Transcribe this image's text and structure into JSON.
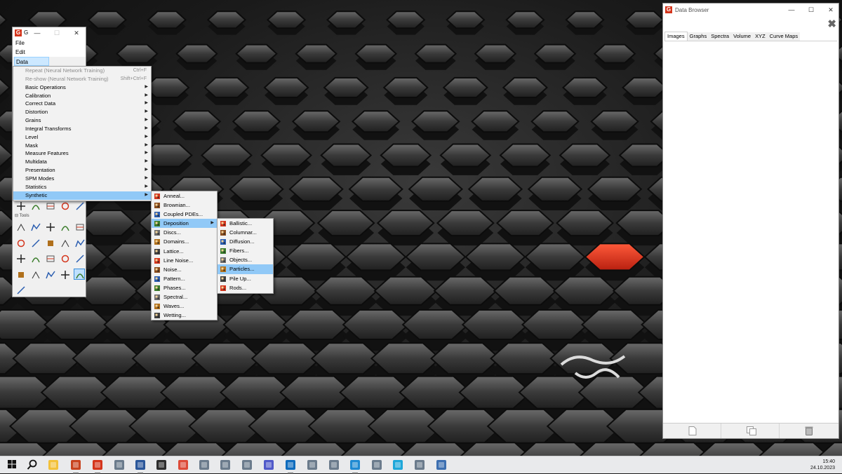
{
  "main_window": {
    "title": "G",
    "menus": [
      "File",
      "Edit",
      "Data Process"
    ],
    "tools_label": "Tools"
  },
  "data_process_menu": [
    {
      "label": "Repeat (Neural Network Training)",
      "shortcut": "Ctrl+F",
      "disabled": true
    },
    {
      "label": "Re-show (Neural Network Training)",
      "shortcut": "Shift+Ctrl+F",
      "disabled": true
    },
    {
      "label": "Basic Operations",
      "submenu": true
    },
    {
      "label": "Calibration",
      "submenu": true
    },
    {
      "label": "Correct Data",
      "submenu": true
    },
    {
      "label": "Distortion",
      "submenu": true
    },
    {
      "label": "Grains",
      "submenu": true
    },
    {
      "label": "Integral Transforms",
      "submenu": true
    },
    {
      "label": "Level",
      "submenu": true
    },
    {
      "label": "Mask",
      "submenu": true
    },
    {
      "label": "Measure Features",
      "submenu": true
    },
    {
      "label": "Multidata",
      "submenu": true
    },
    {
      "label": "Presentation",
      "submenu": true
    },
    {
      "label": "SPM Modes",
      "submenu": true
    },
    {
      "label": "Statistics",
      "submenu": true
    },
    {
      "label": "Synthetic",
      "submenu": true,
      "highlighted": true
    }
  ],
  "synthetic_menu": [
    {
      "label": "Anneal...",
      "icon": "anneal-icon"
    },
    {
      "label": "Brownian...",
      "icon": "brownian-icon"
    },
    {
      "label": "Coupled PDEs...",
      "icon": "coupled-pdes-icon"
    },
    {
      "label": "Deposition",
      "icon": "deposition-icon",
      "submenu": true,
      "highlighted": true
    },
    {
      "label": "Discs...",
      "icon": "discs-icon"
    },
    {
      "label": "Domains...",
      "icon": "domains-icon"
    },
    {
      "label": "Lattice...",
      "icon": "lattice-icon"
    },
    {
      "label": "Line Noise...",
      "icon": "line-noise-icon"
    },
    {
      "label": "Noise...",
      "icon": "noise-icon"
    },
    {
      "label": "Pattern...",
      "icon": "pattern-icon"
    },
    {
      "label": "Phases...",
      "icon": "phases-icon"
    },
    {
      "label": "Spectral...",
      "icon": "spectral-icon"
    },
    {
      "label": "Waves...",
      "icon": "waves-icon"
    },
    {
      "label": "Wetting...",
      "icon": "wetting-icon"
    }
  ],
  "deposition_menu": [
    {
      "label": "Ballistic...",
      "icon": "ballistic-icon"
    },
    {
      "label": "Columnar...",
      "icon": "columnar-icon"
    },
    {
      "label": "Diffusion...",
      "icon": "diffusion-icon"
    },
    {
      "label": "Fibers...",
      "icon": "fibers-icon"
    },
    {
      "label": "Objects...",
      "icon": "objects-icon"
    },
    {
      "label": "Particles...",
      "icon": "particles-icon",
      "highlighted": true
    },
    {
      "label": "Pile Up...",
      "icon": "pile-up-icon"
    },
    {
      "label": "Rods...",
      "icon": "rods-icon"
    }
  ],
  "data_browser": {
    "title": "Data Browser",
    "tabs": [
      "Images",
      "Graphs",
      "Spectra",
      "Volume",
      "XYZ",
      "Curve Maps"
    ],
    "active_tab": "Images"
  },
  "taskbar": {
    "icons": [
      "start-icon",
      "search-icon",
      "file-explorer-icon",
      "powerpoint-icon",
      "gwyddion-icon",
      "app-icon",
      "word-icon",
      "terminal-icon",
      "chrome-icon",
      "app-icon",
      "app-icon",
      "app-icon",
      "teams-icon",
      "outlook-icon",
      "app-icon",
      "app-icon",
      "vscode-icon",
      "app-icon",
      "edge-icon",
      "app-icon",
      "calculator-icon"
    ],
    "time": "15:40",
    "date": "24.10.2023"
  },
  "colors": {
    "menu_highlight": "#91c9f7",
    "gwyddion_red": "#d4351c",
    "desktop_accent": "#e0321a"
  }
}
